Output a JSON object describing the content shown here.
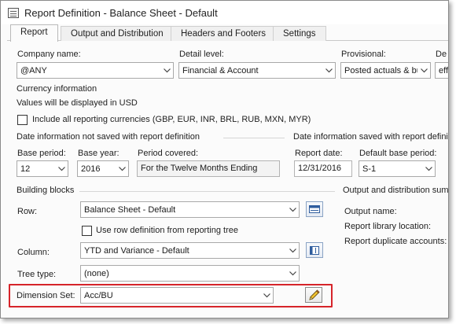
{
  "window": {
    "title": "Report Definition - Balance Sheet - Default"
  },
  "tabs": [
    {
      "label": "Report"
    },
    {
      "label": "Output and Distribution"
    },
    {
      "label": "Headers and Footers"
    },
    {
      "label": "Settings"
    }
  ],
  "top_fields": {
    "company_label": "Company name:",
    "company_value": "@ANY",
    "detail_label": "Detail level:",
    "detail_value": "Financial & Account",
    "provisional_label": "Provisional:",
    "provisional_value": "Posted actuals & bu",
    "de_label": "De",
    "de_value": "eff"
  },
  "currency": {
    "header": "Currency information",
    "info": "Values will be displayed in USD",
    "include_label": "Include all reporting currencies (GBP, EUR, INR, BRL, RUB, MXN, MYR)"
  },
  "date_not_saved": {
    "header": "Date information not saved with report definition",
    "base_period_label": "Base period:",
    "base_period_value": "12",
    "base_year_label": "Base year:",
    "base_year_value": "2016",
    "period_covered_label": "Period covered:",
    "period_covered_value": "For the Twelve Months Ending"
  },
  "date_saved": {
    "header": "Date information saved with report defini",
    "report_date_label": "Report date:",
    "report_date_value": "12/31/2016",
    "default_base_period_label": "Default base period:",
    "default_base_period_value": "S-1"
  },
  "building_blocks": {
    "header": "Building blocks",
    "row_label": "Row:",
    "row_value": "Balance Sheet - Default",
    "use_row_def_label": "Use row definition from reporting tree",
    "column_label": "Column:",
    "column_value": "YTD and Variance - Default",
    "tree_type_label": "Tree type:",
    "tree_type_value": "(none)",
    "dimension_set_label": "Dimension Set:",
    "dimension_set_value": "Acc/BU"
  },
  "output_summary": {
    "header": "Output and distribution sum",
    "output_name_label": "Output name:",
    "library_location_label": "Report library location:",
    "duplicate_accounts_label": "Report duplicate accounts:"
  },
  "colors": {
    "highlight": "#d6242a",
    "accent": "#3b6fb6"
  }
}
